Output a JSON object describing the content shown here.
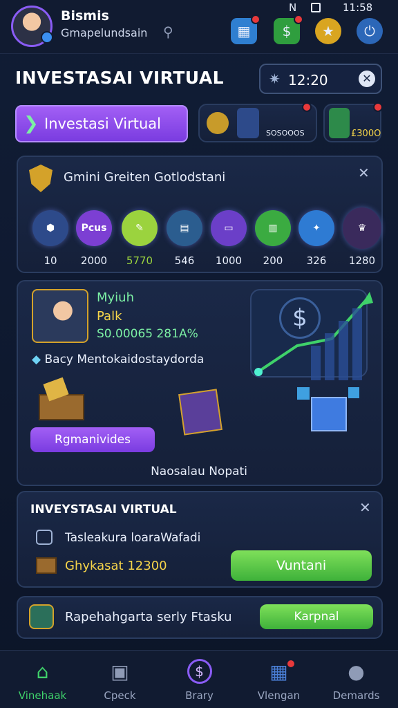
{
  "status_bar": {
    "time": "11:58",
    "signal": "N"
  },
  "profile": {
    "name": "Bismis",
    "subtitle": "Gmapelundsain"
  },
  "header": {
    "title": "INVESTASAI VIRTUAL",
    "timer": "12:20"
  },
  "top_tabs": {
    "active_label": "Investasi Virtual",
    "card1_value": "SOSOOOS",
    "card2_value": "£300O"
  },
  "coins_panel": {
    "title": "Gmini Greiten Gotlodstani",
    "items": [
      {
        "label": "",
        "value": "10",
        "color": "#2d4a8a",
        "icon": "gold-bars-icon"
      },
      {
        "label": "Pcus",
        "value": "2000",
        "color": "#7c3fd3",
        "icon": ""
      },
      {
        "label": "",
        "value": "5770",
        "color": "#9bd33e",
        "icon": "pencil-icon"
      },
      {
        "label": "",
        "value": "546",
        "color": "#2b5d8f",
        "icon": "cube-stack-icon"
      },
      {
        "label": "",
        "value": "1000",
        "color": "#6b3fc8",
        "icon": "ticket-icon"
      },
      {
        "label": "",
        "value": "200",
        "color": "#3bab41",
        "icon": "bar-chart-icon"
      },
      {
        "label": "",
        "value": "326",
        "color": "#2e7bd3",
        "icon": "compass-icon"
      },
      {
        "label": "",
        "value": "1280",
        "color": "#3a2a5c",
        "icon": "crown-icon"
      }
    ]
  },
  "portfolio_panel": {
    "label1": "Myiuh",
    "label2": "Palk",
    "amount": "S0.00065 281A%",
    "desc": "Bacy Mentokaidostaydorda",
    "button": "Rgmanivides",
    "caption": "Naosalau Nopati"
  },
  "invest_panel": {
    "title": "INVEYSTASAI VIRTUAL",
    "row_text": "Tasleakura loaraWafadi",
    "amount": "Ghykasat 12300",
    "button": "Vuntani"
  },
  "offer_row": {
    "text": "Rapehahgarta serly Ftasku",
    "button": "Karpnal"
  },
  "bottom_nav": [
    {
      "label": "Vinehaak",
      "icon": "home-icon",
      "active": true
    },
    {
      "label": "Cpeck",
      "icon": "boxes-icon",
      "active": false
    },
    {
      "label": "Brary",
      "icon": "coin-purse-icon",
      "active": false
    },
    {
      "label": "Vlengan",
      "icon": "calendar-icon",
      "active": false
    },
    {
      "label": "Demards",
      "icon": "user-icon",
      "active": false
    }
  ]
}
